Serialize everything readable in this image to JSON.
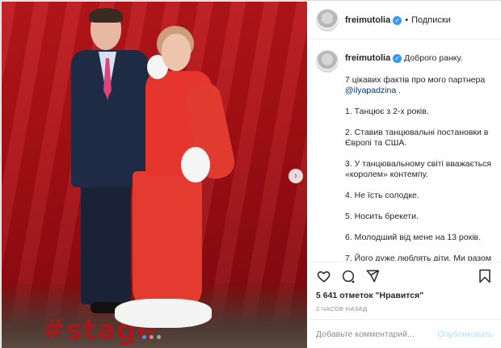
{
  "post": {
    "username": "freimutolia",
    "follow_label": "Подписки",
    "header_separator": "•",
    "photo_watermark": "#stage",
    "carousel": {
      "dots": 3,
      "active_index": 0,
      "next_arrow": "›"
    },
    "caption": {
      "intro": "Доброго ранку.",
      "lead_text": "7 цікавих фактів про мого партнера",
      "mention": "@ilyapadzina",
      "mention_suffix": " .",
      "facts": [
        "1. Танцює з 2-х років.",
        "2. Ставив танцювальні постановки в Європі та США.",
        "3. У танцювальному світі вважається «королем» контемпу.",
        "4. Не їсть солодке.",
        "5. Носить брекети.",
        "6. Молодший від мене на 13 років.",
        "7. Його дуже люблять діти. Ми разом"
      ]
    },
    "actions": {
      "like_icon": "heart-icon",
      "comment_icon": "comment-icon",
      "share_icon": "share-icon",
      "save_icon": "bookmark-icon"
    },
    "likes_text": "5 641 отметок \"Нравится\"",
    "time_text": "2 ЧАСОВ НАЗАД",
    "comment": {
      "placeholder": "Добавьте комментарий...",
      "publish_label": "Опубликовать"
    },
    "colors": {
      "verified": "#3897f0",
      "publish_disabled": "#b2dffc",
      "mention": "#00376b",
      "backdrop": "#c0181c"
    }
  }
}
